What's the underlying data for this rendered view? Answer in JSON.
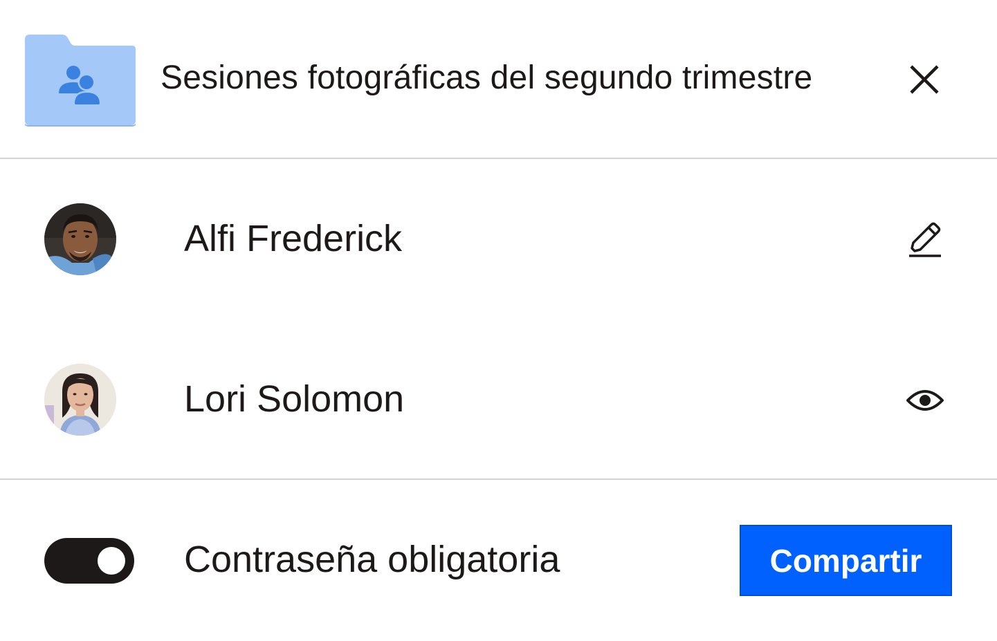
{
  "header": {
    "title": "Sesiones fotográficas del segundo trimestre",
    "folder_icon": "shared-folder-icon",
    "close_icon": "close-icon"
  },
  "members": [
    {
      "name": "Alfi Frederick",
      "permission_icon": "pencil-icon",
      "avatar": "avatar-photo"
    },
    {
      "name": "Lori Solomon",
      "permission_icon": "eye-icon",
      "avatar": "avatar-photo"
    }
  ],
  "footer": {
    "toggle_label": "Contraseña obligatoria",
    "toggle_on": true,
    "share_label": "Compartir"
  },
  "colors": {
    "accent": "#0061fe",
    "folder": "#a4c8f8",
    "folder_person": "#3b82e0",
    "text": "#1e1919",
    "divider": "#d4d2d0"
  }
}
